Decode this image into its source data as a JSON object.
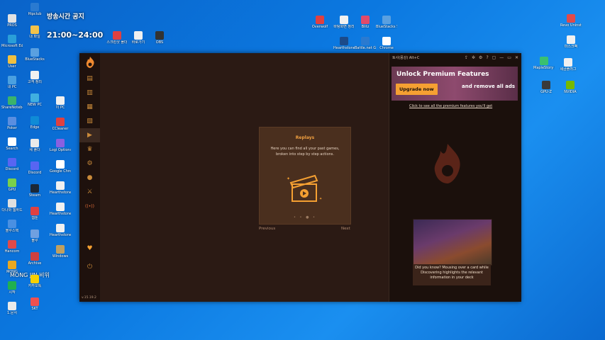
{
  "desktop": {
    "broadcast_title": "방송시간 공지",
    "broadcast_time": "21:00~24:00",
    "streamer_label": "MONG JIN 비위",
    "icons_left": [
      {
        "label": "PROS",
        "color": "#e2e2e2"
      },
      {
        "label": "Microsoft Edge",
        "color": "#2a9fd8"
      },
      {
        "label": "User",
        "color": "#f0c040"
      },
      {
        "label": "내 PC",
        "color": "#4aa0e0"
      },
      {
        "label": "ShareNotebook",
        "color": "#3bb36b"
      },
      {
        "label": "Poker",
        "color": "#5a8ee0"
      },
      {
        "label": "Search",
        "color": "#ffffff"
      },
      {
        "label": "Discord",
        "color": "#5865f2"
      },
      {
        "label": "GPU",
        "color": "#7ad04a"
      },
      {
        "label": "다나와 웹하드",
        "color": "#e0e0e0"
      },
      {
        "label": "블루스택",
        "color": "#4a90e2"
      },
      {
        "label": "Hancom",
        "color": "#e04a4a"
      },
      {
        "label": "MONG",
        "color": "#e9a820"
      },
      {
        "label": "시작",
        "color": "#20b050"
      },
      {
        "label": "1.문서",
        "color": "#eaeaea"
      }
    ],
    "icons_col2": [
      {
        "label": "Hipclub",
        "color": "#2a7ad0"
      },
      {
        "label": "내 파일",
        "color": "#f3c24a"
      },
      {
        "label": "BlueStacks",
        "color": "#5aa0e0"
      },
      {
        "label": "고객 정리",
        "color": "#f0f0f0"
      },
      {
        "label": "NEW PC",
        "color": "#40b0e0"
      },
      {
        "label": "Edge",
        "color": "#0f8bd6"
      },
      {
        "label": "새 폴더",
        "color": "#eaeaea"
      },
      {
        "label": "Discord",
        "color": "#5865f2"
      },
      {
        "label": "Steam",
        "color": "#1b2838"
      },
      {
        "label": "웹툰",
        "color": "#e04040"
      },
      {
        "label": "블루",
        "color": "#6fa0e0"
      },
      {
        "label": "Archive",
        "color": "#d04040"
      },
      {
        "label": "카카오톡",
        "color": "#f7d000"
      },
      {
        "label": "SKT",
        "color": "#f05050"
      }
    ],
    "icons_col3": [
      {
        "label": "이 PC",
        "color": "#f0f0f0"
      },
      {
        "label": "CCleaner",
        "color": "#e04040"
      },
      {
        "label": "Logi Options+",
        "color": "#8a60e0"
      },
      {
        "label": "Google Chrome",
        "color": "#ffffff"
      },
      {
        "label": "Hearthstone Screenshot",
        "color": "#f0f0f0"
      },
      {
        "label": "Hearthstone Screenshot",
        "color": "#f0f0f0"
      },
      {
        "label": "Hearthstone Screenshot",
        "color": "#f0f0f0"
      },
      {
        "label": "Windows",
        "color": "#c0a060"
      }
    ],
    "icons_top": [
      {
        "label": "스크린샷 폴더",
        "color": "#e04040"
      },
      {
        "label": "바로가기",
        "color": "#f0f0f0"
      },
      {
        "label": "OBS",
        "color": "#333333"
      },
      {
        "label": "Overwolf",
        "color": "#e04040"
      },
      {
        "label": "바탕화면 정리",
        "color": "#f0f0f0"
      },
      {
        "label": "Blitz",
        "color": "#e04a6a"
      },
      {
        "label": "BlueStacks 5",
        "color": "#5aa0e0"
      },
      {
        "label": "Hearthstone",
        "color": "#1b4a8a"
      },
      {
        "label": "Battle.net Games",
        "color": "#2a7ad0"
      },
      {
        "label": "Chrome",
        "color": "#ffffff"
      }
    ],
    "icons_right": [
      {
        "label": "Revo Uninstaller",
        "color": "#e04a4a"
      },
      {
        "label": "마스크팩",
        "color": "#f0f0f0"
      },
      {
        "label": "MapleStory Worlds",
        "color": "#3ac070"
      },
      {
        "label": "세금플러그",
        "color": "#f0f0f0"
      },
      {
        "label": "GPU-Z",
        "color": "#3a3a3a"
      },
      {
        "label": "NVIDIA",
        "color": "#76b900"
      }
    ]
  },
  "app": {
    "version": "v.15.19.2",
    "sidebar_items": [
      {
        "name": "sidebar-item-cards",
        "glyph": "▤"
      },
      {
        "name": "sidebar-item-decks",
        "glyph": "▥"
      },
      {
        "name": "sidebar-item-collection",
        "glyph": "▦"
      },
      {
        "name": "sidebar-item-packs",
        "glyph": "▧"
      },
      {
        "name": "sidebar-item-replays",
        "glyph": "▶"
      },
      {
        "name": "sidebar-item-battlegrounds",
        "glyph": "♛"
      },
      {
        "name": "sidebar-item-arena",
        "glyph": "⚙"
      },
      {
        "name": "sidebar-item-quests",
        "glyph": "●"
      },
      {
        "name": "sidebar-item-mercenaries",
        "glyph": "⚔"
      },
      {
        "name": "sidebar-item-live",
        "glyph": "((•))"
      },
      {
        "name": "sidebar-item-favorites",
        "glyph": "♥"
      },
      {
        "name": "sidebar-item-settings",
        "glyph": "⏻"
      }
    ],
    "window_title": "토사(몽강) Alt+C",
    "window_controls": [
      "share-icon",
      "bug-icon",
      "settings-icon",
      "help-icon",
      "discord-icon",
      "minimize-icon",
      "maximize-icon",
      "close-icon"
    ],
    "window_glyphs": [
      "⇪",
      "✲",
      "⚙",
      "?",
      "▢",
      "—",
      "▭",
      "✕"
    ],
    "replays_card": {
      "title": "Replays",
      "description": "Here you can find all your past games, broken into step by step actions.",
      "prev_label": "Previous",
      "next_label": "Next",
      "dots": "• • ● •"
    },
    "promo": {
      "heading": "Unlock Premium Features",
      "button_label": "Upgrade now",
      "subtext": "and remove all ads",
      "link": "Click to see all the premium features you'll get"
    },
    "tip": {
      "text": "Did you know? Mousing over a card while Discovering highlights the relevant information in your deck"
    },
    "colors": {
      "accent": "#f5a032",
      "bg": "#2b1a14",
      "sidebar": "#1e110d"
    }
  }
}
